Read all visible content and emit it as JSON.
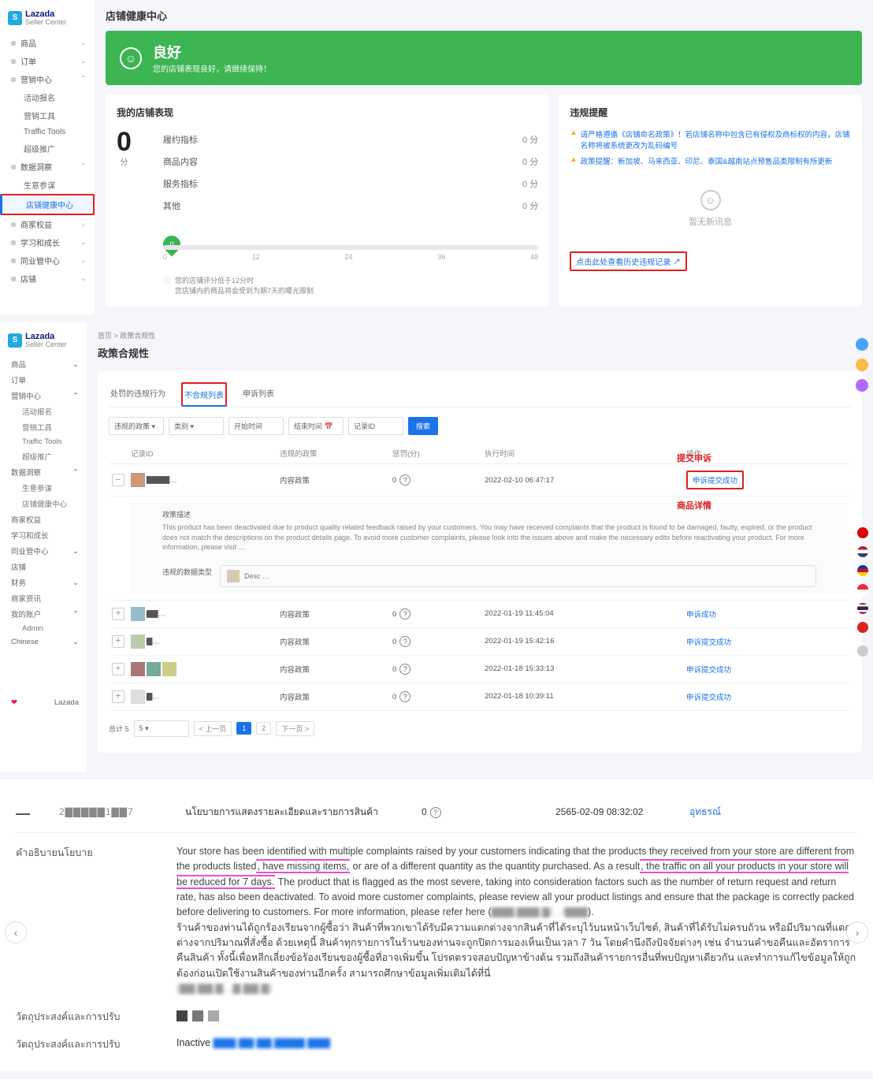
{
  "brand": {
    "name": "Lazada",
    "sub": "Seller Center"
  },
  "secA": {
    "title": "店铺健康中心",
    "sidebar": [
      {
        "label": "商品",
        "chev": true
      },
      {
        "label": "订单",
        "chev": true
      },
      {
        "label": "营销中心",
        "chev": true,
        "children": [
          "活动报名",
          "营销工具",
          "Traffic Tools",
          "超级推广"
        ]
      },
      {
        "label": "数据洞察",
        "chev": true,
        "children": [
          "生意参谋",
          "店铺健康中心"
        ]
      },
      {
        "label": "商家权益",
        "chev": true
      },
      {
        "label": "学习和成长",
        "chev": true
      },
      {
        "label": "同业管中心",
        "chev": true
      },
      {
        "label": "店铺",
        "chev": true
      }
    ],
    "banner": {
      "title": "良好",
      "sub": "您的店铺表现良好，请继续保持！"
    },
    "scorecard": {
      "title": "我的店铺表现",
      "score": "0",
      "unit": "分",
      "metrics": [
        {
          "k": "履约指标",
          "v": "0 分"
        },
        {
          "k": "商品内容",
          "v": "0 分"
        },
        {
          "k": "服务指标",
          "v": "0 分"
        },
        {
          "k": "其他",
          "v": "0 分"
        }
      ],
      "slider": {
        "knob": "0",
        "ticks": [
          "0",
          "12",
          "24",
          "36",
          "48"
        ]
      },
      "note1": "您的店铺评分低于12分时",
      "note2": "您店铺内的商品将会受到为期7天的曝光限制"
    },
    "alerts": {
      "title": "违规提醒",
      "lines": [
        "请严格遵循《店铺命名政策》！若店铺名称中包含已有侵权及商标权的内容，店铺名称将被系统更改为乱码编号",
        "政策提醒：新加坡、马来西亚、印尼、泰国&越南站点预售品类限制有所更新"
      ],
      "empty": "暂无新讯息",
      "link": "点击此处查看历史违规记录"
    }
  },
  "secB": {
    "sidebar": [
      {
        "label": "商品",
        "chev": true
      },
      {
        "label": "订单"
      },
      {
        "label": "营销中心",
        "chev": true,
        "children": [
          "活动报名",
          "营销工具",
          "Traffic Tools",
          "超级推广"
        ]
      },
      {
        "label": "数据洞察",
        "chev": true,
        "children": [
          "生意参谋",
          "店铺健康中心"
        ]
      },
      {
        "label": "商家权益"
      },
      {
        "label": "学习和成长"
      },
      {
        "label": "同业管中心",
        "chev": true
      },
      {
        "label": "店铺"
      },
      {
        "label": "财务",
        "chev": true
      },
      {
        "label": "商家资讯"
      },
      {
        "label": "我的账户",
        "chev": true,
        "children": [
          "Admin"
        ]
      },
      {
        "label": "Chinese",
        "chev": true
      }
    ],
    "crumb": "首页 > 政策合规性",
    "title": "政策合规性",
    "tabs": [
      "处罚的违规行为",
      "不合规列表",
      "申诉列表"
    ],
    "activeTab": 1,
    "filters": {
      "f1": "违规的政策",
      "f2": "类别",
      "f3": "开始时间",
      "f4": "结束时间",
      "f5": "记录ID",
      "btn": "搜索"
    },
    "cols": [
      "",
      "记录ID",
      "违规的政策",
      "惩罚(分)",
      "执行时间",
      "操作"
    ],
    "rows": [
      {
        "id": "▇▇▇▇…",
        "policy": "内容政策",
        "pen": "0",
        "time": "2022-02-10 06:47:17",
        "op": "申诉提交成功"
      },
      {
        "id": "▇▇…",
        "policy": "内容政策",
        "pen": "0",
        "time": "2022-01-19 11:45:04",
        "op": "申诉成功"
      },
      {
        "id": "▇…",
        "policy": "内容政策",
        "pen": "0",
        "time": "2022-01-19 15:42:16",
        "op": "申诉提交成功"
      },
      {
        "id": "▇ ▇ ▇",
        "policy": "内容政策",
        "pen": "0",
        "time": "2022-01-18 15:33:13",
        "op": "申诉提交成功"
      },
      {
        "id": "▇…",
        "policy": "内容政策",
        "pen": "0",
        "time": "2022-01-18 10:39:11",
        "op": "申诉提交成功"
      }
    ],
    "expand": {
      "lblPolicy": "政策描述",
      "desc": "This product has been deactivated due to product quality related feedback raised by your customers. You may have received complaints that the product is found to be damaged, faulty, expired, or the product does not match the descriptions on the product details page. To avoid more customer complaints, please look into the issues above and make the necessary edits before reactivating your product. For more information, please visit …",
      "lblProd": "违规的数据类型",
      "prod": "Desc …"
    },
    "annot1": "提交申诉",
    "annot2": "商品详情",
    "pager": {
      "total": "总计 5",
      "sel": "5",
      "prev": "< 上一页",
      "p1": "1",
      "p2": "2",
      "next": "下一页 >"
    },
    "footer": "Lazada"
  },
  "secC": {
    "row": {
      "id": "2▇▇▇▇▇1▇▇7",
      "policy": "นโยบายการแสดงรายละเอียดและรายการสินค้า",
      "pen": "0",
      "time": "2565-02-09 08:32:02",
      "op": "อุทธรณ์"
    },
    "lblDesc": "คำอธิบายนโยบาย",
    "desc_en_1": "Your store has been identified with multiple complaints raised by your customers indicating that the products they received from your store are different from the products listed",
    "desc_en_hl1": ", have missing items,",
    "desc_en_2": " or are of a different quantity as the quantity purchased. As a result",
    "desc_en_hl2": ", the traffic on all your products in your store will be reduced for 7 days.",
    "desc_en_3": " The product that is flagged as the most severe, taking into consideration factors such as the number of return request and return rate, has also been deactivated. To avoid more customer complaints, please review all your product listings and ensure that the package is correctly packed before delivering to customers. For more information, please refer here (",
    "desc_en_blur": "▇▇▇.▇▇▇.▇/…/▇▇▇",
    "desc_en_4": ").",
    "desc_th": "   ร้านค้าของท่านได้ถูกร้องเรียนจากผู้ซื้อว่า สินค้าที่พวกเขาได้รับมีความแตกต่างจากสินค้าที่ได้ระบุไว้บนหน้าเว็บไซต์, สินค้าที่ได้รับไม่ครบถ้วน หรือมีปริมาณที่แตกต่างจากปริมาณที่สั่งซื้อ ด้วยเหตุนี้ สินค้าทุกรายการในร้านของท่านจะถูกปิดการมองเห็นเป็นเวลา 7 วัน โดยคำนึงถึงปัจจัยต่างๆ เช่น จำนวนคำขอคืนและอัตราการคืนสินค้า ทั้งนี้เพื่อหลีกเลี่ยงข้อร้องเรียนของผู้ซื้อที่อาจเพิ่มขึ้น โปรดตรวจสอบปัญหาข้างต้น รวมถึงสินค้ารายการอื่นที่พบปัญหาเดียวกัน และทำการแก้ไขข้อมูลให้ถูกต้องก่อนเปิดใช้งานสินค้าของท่านอีกครั้ง สามารถศึกษาข้อมูลเพิ่มเติมได้ที่นี่",
    "desc_th_blur": "(▇▇.▇▇.▇…▇.▇▇.▇)",
    "lblProd": "วัตถุประสงค์และการปรับ",
    "lblProd2": "วัตถุประสงค์และการปรับ",
    "prod2_a": "Inactive ",
    "prod2_link": "▇▇▇ ▇▇ ▇▇ ▇▇▇▇ ▇▇▇"
  }
}
